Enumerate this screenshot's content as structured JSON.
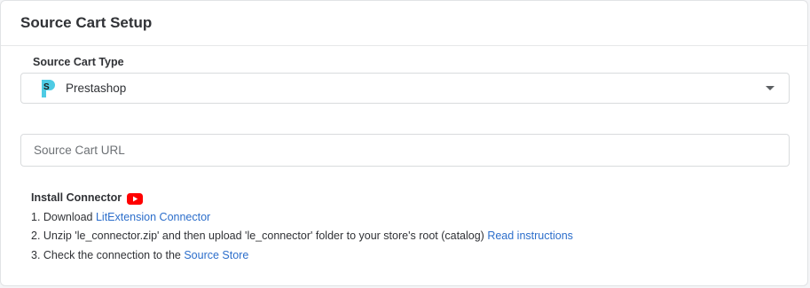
{
  "header": {
    "title": "Source Cart Setup"
  },
  "cart_type": {
    "label": "Source Cart Type",
    "selected": "Prestashop",
    "icon": "prestashop-logo-icon"
  },
  "url_field": {
    "placeholder": "Source Cart URL",
    "value": ""
  },
  "install": {
    "title": "Install Connector",
    "video_icon": "youtube-icon",
    "step1_prefix": "1. Download ",
    "step1_link": "LitExtension Connector",
    "step2_prefix": "2. Unzip 'le_connector.zip' and then upload 'le_connector' folder to your store's root (catalog) ",
    "step2_link": "Read instructions",
    "step3_prefix": "3. Check the connection to the ",
    "step3_link": "Source Store"
  },
  "colors": {
    "link": "#2c6ecb",
    "youtube_red": "#ff0000",
    "prestashop_cyan": "#4ecbe4"
  }
}
